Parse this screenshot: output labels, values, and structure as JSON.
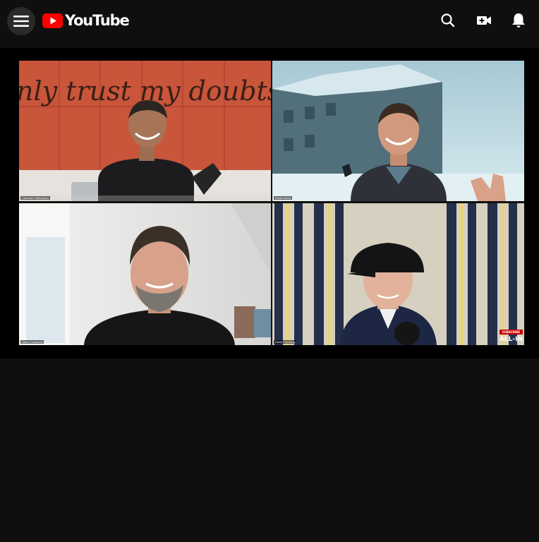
{
  "header": {
    "logo_text": "YouTube",
    "icons": [
      "menu-icon",
      "youtube-play-icon",
      "search-icon",
      "create-video-icon",
      "notifications-bell-icon"
    ],
    "brand_color": "#ff0000"
  },
  "video": {
    "wall_text": "nly trust my doubts",
    "participants": [
      {
        "name": "Chamath Palihapitiya"
      },
      {
        "name": "David Sacks"
      },
      {
        "name": "Jason Calacanis"
      },
      {
        "name": "David Friedberg"
      }
    ],
    "subscribe_badge": "SUBSCRIBE",
    "watermark": "ALL-IN"
  }
}
